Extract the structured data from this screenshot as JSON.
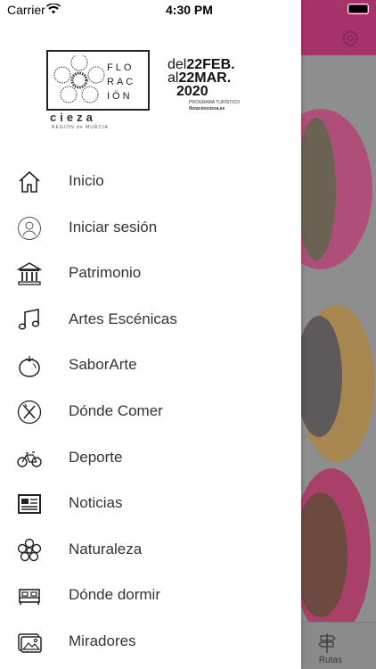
{
  "status": {
    "carrier": "Carrier",
    "time": "4:30 PM"
  },
  "logo": {
    "letters": [
      "FLO",
      "RAC",
      "IÖN"
    ],
    "city": "cieza",
    "region": "REGIÓN de MURCIA"
  },
  "dates": {
    "pre1": "del",
    "d1": "22FEB.",
    "pre2": "al",
    "d2": "22MAR.",
    "year": "2020",
    "program": "PROGRAMA TURÍSTICO",
    "website": "floracioncieza.es"
  },
  "menu": [
    {
      "label": "Inicio",
      "icon": "home-icon"
    },
    {
      "label": "Iniciar sesión",
      "icon": "user-icon"
    },
    {
      "label": "Patrimonio",
      "icon": "monument-icon"
    },
    {
      "label": "Artes Escénicas",
      "icon": "music-note-icon"
    },
    {
      "label": "SaborArte",
      "icon": "tomato-icon"
    },
    {
      "label": "Dónde Comer",
      "icon": "cutlery-icon"
    },
    {
      "label": "Deporte",
      "icon": "bicycle-icon"
    },
    {
      "label": "Noticias",
      "icon": "newspaper-icon"
    },
    {
      "label": "Naturaleza",
      "icon": "flower-icon"
    },
    {
      "label": "Dónde dormir",
      "icon": "bed-icon"
    },
    {
      "label": "Miradores",
      "icon": "picture-icon"
    }
  ],
  "tabbar": {
    "routes_label": "Rutas"
  },
  "colors": {
    "header": "#a8326c",
    "drawer": "#ffffff",
    "text": "#333333"
  }
}
